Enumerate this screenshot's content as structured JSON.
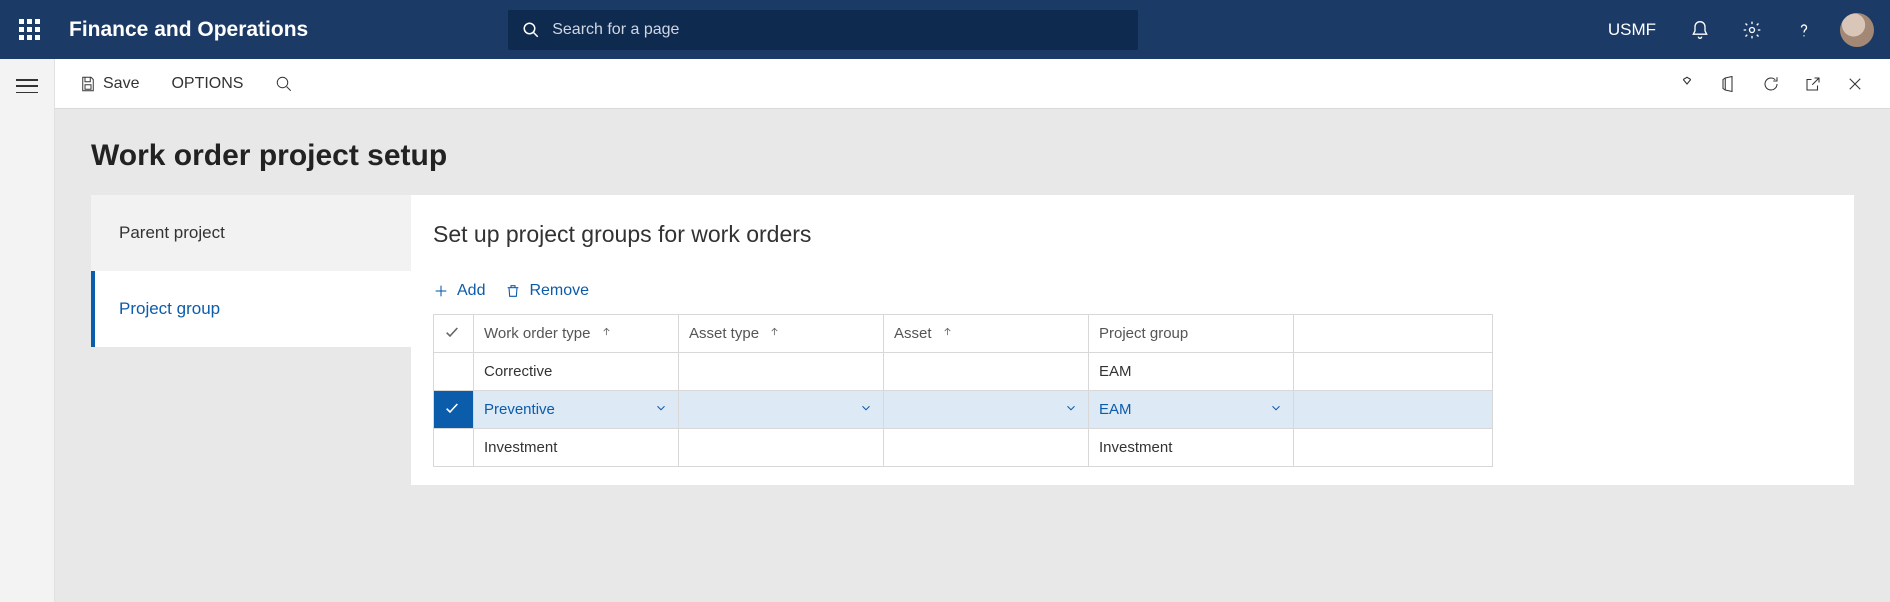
{
  "header": {
    "app_title": "Finance and Operations",
    "search_placeholder": "Search for a page",
    "company_code": "USMF"
  },
  "actionbar": {
    "save_label": "Save",
    "options_label": "OPTIONS"
  },
  "page": {
    "title": "Work order project setup",
    "tabs": [
      {
        "label": "Parent project",
        "active": false
      },
      {
        "label": "Project group",
        "active": true
      }
    ]
  },
  "panel": {
    "title": "Set up project groups for work orders",
    "toolbar": {
      "add_label": "Add",
      "remove_label": "Remove"
    },
    "columns": {
      "work_order_type": "Work order type",
      "asset_type": "Asset type",
      "asset": "Asset",
      "project_group": "Project group"
    },
    "rows": [
      {
        "selected": false,
        "work_order_type": "Corrective",
        "asset_type": "",
        "asset": "",
        "project_group": "EAM"
      },
      {
        "selected": true,
        "work_order_type": "Preventive",
        "asset_type": "",
        "asset": "",
        "project_group": "EAM"
      },
      {
        "selected": false,
        "work_order_type": "Investment",
        "asset_type": "",
        "asset": "",
        "project_group": "Investment"
      }
    ]
  }
}
